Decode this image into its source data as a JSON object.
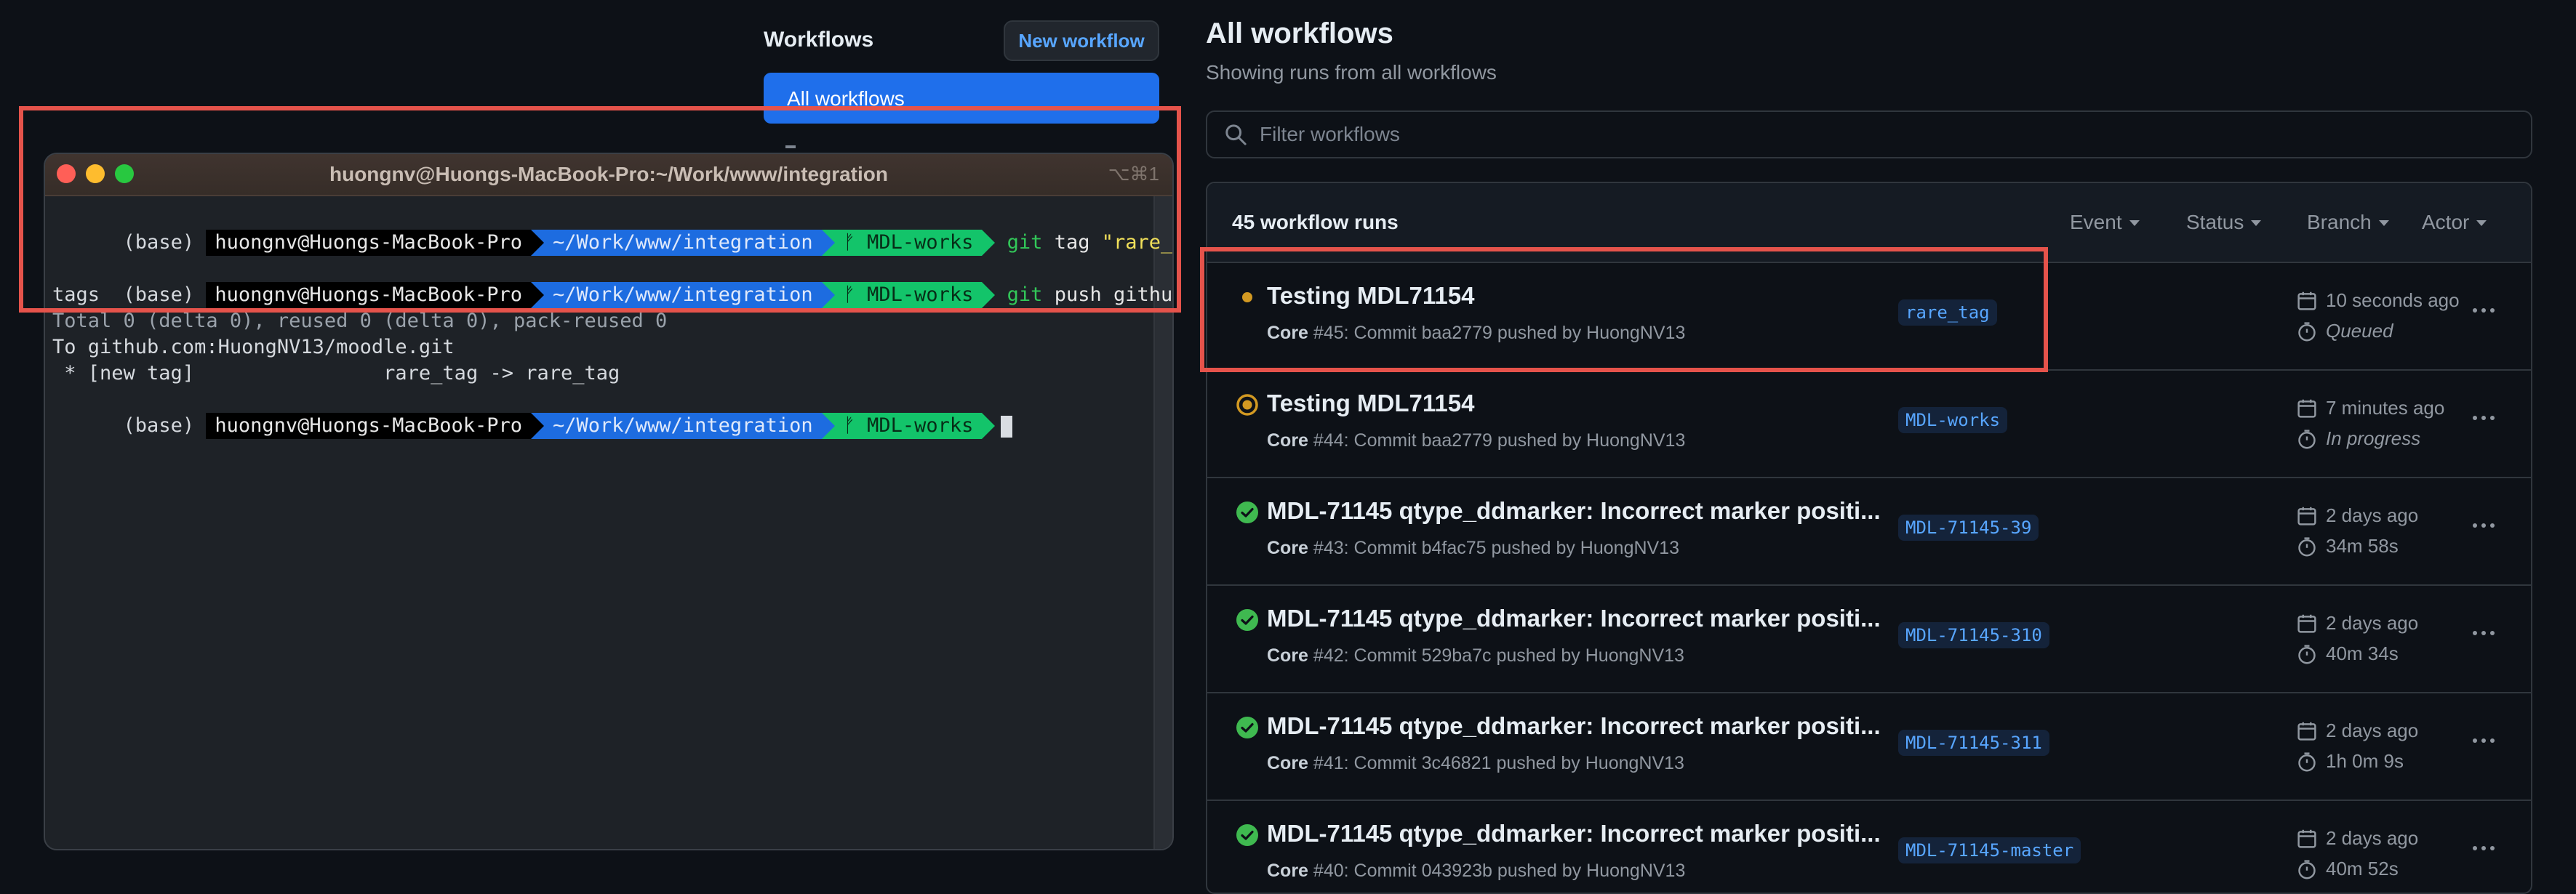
{
  "sidebar": {
    "title": "Workflows",
    "new_workflow_label": "New workflow",
    "all_workflows_label": "All workflows"
  },
  "terminal": {
    "title": "huongnv@Huongs-MacBook-Pro:~/Work/www/integration",
    "shortcut": "⌥⌘1",
    "prompt": {
      "env": "(base)",
      "host": "huongnv@Huongs-MacBook-Pro",
      "path": "~/Work/www/integration",
      "branch": "ᚠ MDL-works"
    },
    "commands": [
      {
        "git": "git",
        "rest": " tag ",
        "string": "\"rare_tag\""
      },
      {
        "git": "git",
        "rest": " push github --",
        "string": ""
      }
    ],
    "output_lines": [
      "tags",
      "Total 0 (delta 0), reused 0 (delta 0), pack-reused 0",
      "To github.com:HuongNV13/moodle.git",
      " * [new tag]                rare_tag -> rare_tag"
    ]
  },
  "main": {
    "title": "All workflows",
    "subtitle": "Showing runs from all workflows",
    "filter_placeholder": "Filter workflows",
    "runs_count": "45 workflow runs",
    "filters": [
      "Event",
      "Status",
      "Branch",
      "Actor"
    ],
    "runs": [
      {
        "status": "queued",
        "title": "Testing MDL71154",
        "workflow": "Core",
        "meta": " #45: Commit baa2779 pushed by HuongNV13",
        "branch": "rare_tag",
        "time": "10 seconds ago",
        "duration": "Queued"
      },
      {
        "status": "in_progress",
        "title": "Testing MDL71154",
        "workflow": "Core",
        "meta": " #44: Commit baa2779 pushed by HuongNV13",
        "branch": "MDL-works",
        "time": "7 minutes ago",
        "duration": "In progress"
      },
      {
        "status": "success",
        "title": "MDL-71145 qtype_ddmarker: Incorrect marker positi...",
        "workflow": "Core",
        "meta": " #43: Commit b4fac75 pushed by HuongNV13",
        "branch": "MDL-71145-39",
        "time": "2 days ago",
        "duration": "34m 58s"
      },
      {
        "status": "success",
        "title": "MDL-71145 qtype_ddmarker: Incorrect marker positi...",
        "workflow": "Core",
        "meta": " #42: Commit 529ba7c pushed by HuongNV13",
        "branch": "MDL-71145-310",
        "time": "2 days ago",
        "duration": "40m 34s"
      },
      {
        "status": "success",
        "title": "MDL-71145 qtype_ddmarker: Incorrect marker positi...",
        "workflow": "Core",
        "meta": " #41: Commit 3c46821 pushed by HuongNV13",
        "branch": "MDL-71145-311",
        "time": "2 days ago",
        "duration": "1h 0m 9s"
      },
      {
        "status": "success",
        "title": "MDL-71145 qtype_ddmarker: Incorrect marker positi...",
        "workflow": "Core",
        "meta": " #40: Commit 043923b pushed by HuongNV13",
        "branch": "MDL-71145-master",
        "time": "2 days ago",
        "duration": "40m 52s"
      }
    ]
  },
  "colors": {
    "accent": "#1f6feb",
    "link": "#58a6ff",
    "success": "#3fb950",
    "pending": "#d29922",
    "highlight": "#e5534b"
  },
  "icons": [
    "search-icon",
    "calendar-icon",
    "stopwatch-icon",
    "kebab-icon",
    "check-circle-icon",
    "queued-dot-icon",
    "in-progress-icon"
  ]
}
